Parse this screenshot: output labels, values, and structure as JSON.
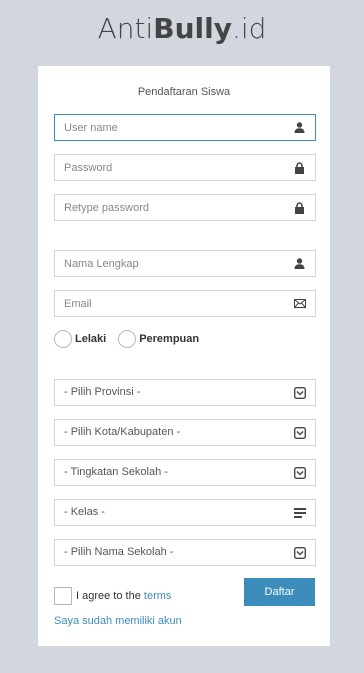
{
  "logo": {
    "prefix": "Anti",
    "bold": "Bully",
    "suffix": ".id"
  },
  "form": {
    "title": "Pendaftaran Siswa",
    "username": {
      "placeholder": "User name",
      "icon": "user-icon"
    },
    "password": {
      "placeholder": "Password",
      "icon": "lock-icon"
    },
    "retype_password": {
      "placeholder": "Retype password",
      "icon": "lock-icon"
    },
    "full_name": {
      "placeholder": "Nama Lengkap",
      "icon": "user-icon"
    },
    "email": {
      "placeholder": "Email",
      "icon": "envelope-icon"
    },
    "gender": {
      "male_label": "Lelaki",
      "female_label": "Perempuan"
    },
    "province": {
      "selected": "- Pilih Provinsi -",
      "icon": "select-icon"
    },
    "city": {
      "selected": "- Pilih Kota/Kabupaten -",
      "icon": "select-icon"
    },
    "school_level": {
      "selected": "- Tingkatan Sekolah -",
      "icon": "select-icon"
    },
    "grade": {
      "selected": "- Kelas -",
      "icon": "list-icon"
    },
    "school_name": {
      "selected": "- Pilih Nama Sekolah -",
      "icon": "select-icon"
    },
    "agree": {
      "prefix": "I agree to the ",
      "terms_link": "terms"
    },
    "submit_label": "Daftar",
    "login_link": "Saya sudah memiliki akun"
  },
  "colors": {
    "accent": "#3c8dbc",
    "background": "#d2d6de",
    "icon": "#444444"
  }
}
